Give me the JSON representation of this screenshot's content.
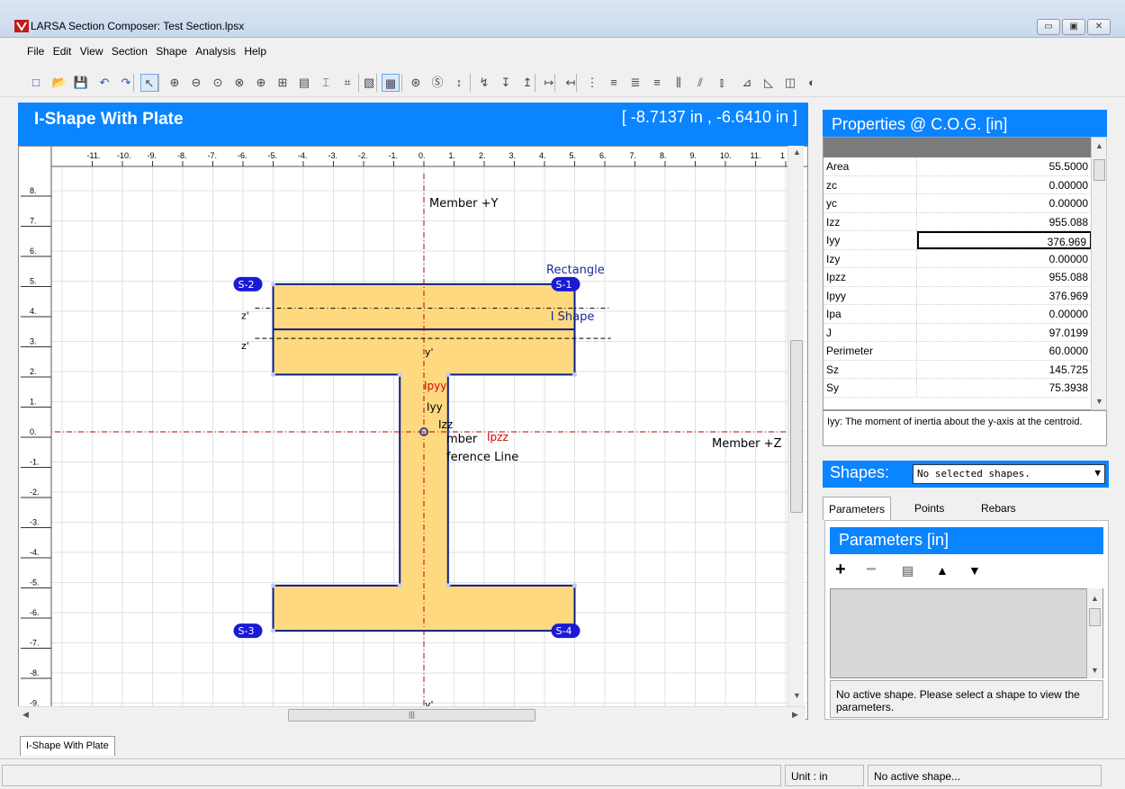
{
  "window": {
    "title": "LARSA Section Composer: Test Section.lpsx",
    "buttons": [
      "▭",
      "▣",
      "✕"
    ]
  },
  "menu": [
    "File",
    "Edit",
    "View",
    "Section",
    "Shape",
    "Analysis",
    "Help"
  ],
  "toolbar_icons": [
    "new-file-icon",
    "open-folder-icon",
    "save-icon",
    "undo-icon",
    "redo-icon",
    "pointer-icon",
    "zoom-in-icon",
    "zoom-out-icon",
    "zoom-window-icon",
    "zoom-previous-icon",
    "zoom-fit-icon",
    "zoom-extents-icon",
    "copy-shape-icon",
    "i-shape-icon",
    "polygon-icon",
    "edit-icon",
    "grid-icon",
    "centroid-icon",
    "shear-center-icon",
    "axes-icon",
    "plastic-icon",
    "stress-points-icon",
    "principal-axes-icon",
    "decimal-increase-icon",
    "decimal-decrease-icon",
    "align-icon",
    "align-left-icon",
    "align-center-icon",
    "align-right-icon",
    "align-top-icon",
    "align-middle-icon",
    "align-bottom-icon",
    "flip-horizontal-icon",
    "flip-vertical-icon",
    "mirror-icon",
    "rotate-icon"
  ],
  "view": {
    "title": "I-Shape With Plate",
    "coords": "[ -8.7137 in , -6.6410 in ]",
    "tab_label": "I-Shape With Plate"
  },
  "ruler": {
    "x": [
      "-11.",
      "-10.",
      "-9.",
      "-8.",
      "-7.",
      "-6.",
      "-5.",
      "-4.",
      "-3.",
      "-2.",
      "-1.",
      "0.",
      "1.",
      "2.",
      "3.",
      "4.",
      "5.",
      "6.",
      "7.",
      "8.",
      "9.",
      "10.",
      "11.",
      "1"
    ],
    "y": [
      "8.",
      "7.",
      "6.",
      "5.",
      "4.",
      "3.",
      "2.",
      "1.",
      "0.",
      "-1.",
      "-2.",
      "-3.",
      "-4.",
      "-5.",
      "-6.",
      "-7.",
      "-8.",
      "-9."
    ]
  },
  "canvas_labels": {
    "member_y": "Member +Y",
    "member_z": "Member +Z",
    "rectangle": "Rectangle",
    "i_shape": "I Shape",
    "z1": "z'",
    "z2": "z'",
    "y1": "y'",
    "y2": "y'",
    "ipyy": "Ipyy",
    "iyy": "Iyy",
    "izz": "Izz",
    "ipzz": "Ipzz",
    "member_ref1": "mber",
    "member_ref2": "ference Line",
    "tags": [
      "S-1",
      "S-2",
      "S-3",
      "S-4"
    ]
  },
  "properties": {
    "header": "Properties @ C.O.G. [in]",
    "rows": [
      {
        "name": "Area",
        "value": "55.5000"
      },
      {
        "name": "zc",
        "value": "0.00000"
      },
      {
        "name": "yc",
        "value": "0.00000"
      },
      {
        "name": "Izz",
        "value": "955.088"
      },
      {
        "name": "Iyy",
        "value": "376.969"
      },
      {
        "name": "Izy",
        "value": "0.00000"
      },
      {
        "name": "Ipzz",
        "value": "955.088"
      },
      {
        "name": "Ipyy",
        "value": "376.969"
      },
      {
        "name": "Ipa",
        "value": "0.00000"
      },
      {
        "name": "J",
        "value": "97.0199"
      },
      {
        "name": "Perimeter",
        "value": "60.0000"
      },
      {
        "name": "Sz",
        "value": "145.725"
      },
      {
        "name": "Sy",
        "value": "75.3938"
      }
    ],
    "description": "Iyy: The moment of inertia about the y-axis at the centroid."
  },
  "shapes": {
    "label": "Shapes:",
    "selected": "No selected shapes."
  },
  "tabs": [
    "Parameters",
    "Points",
    "Rebars"
  ],
  "parameters": {
    "header": "Parameters [in]",
    "tools": [
      "+",
      "−",
      "▤",
      "▲",
      "▼"
    ],
    "message": "No active shape. Please select a shape to view the parameters."
  },
  "status": {
    "unit": "Unit : in",
    "message": "No active shape..."
  },
  "colors": {
    "accent": "#0b84ff",
    "shape_fill": "#ffd97f",
    "shape_stroke": "#0a1f8a"
  }
}
